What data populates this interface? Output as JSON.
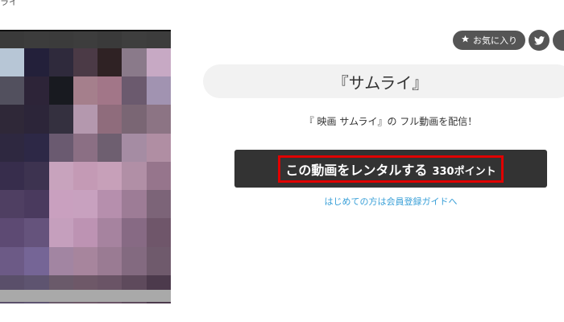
{
  "breadcrumb": "ライ",
  "actions": {
    "favorite_label": "お気に入り",
    "favorite_icon": "star-icon",
    "twitter_icon": "twitter-icon"
  },
  "video": {
    "title": "『サムライ』",
    "description": "『 映画 サムライ』の フル動画を配信！",
    "rent_label": "この動画をレンタルする",
    "rent_points": "330ポイント",
    "guide_link": "はじめての方は会員登録ガイドへ"
  },
  "colors": {
    "button_bg": "#333333",
    "highlight_border": "#e00000",
    "link": "#3aa0d8",
    "action_bg": "#555555",
    "title_bg": "#f2f2f2"
  },
  "thumbnail": {
    "description_free": true,
    "mosaic": [
      "#3a3a3a",
      "#3c3c3c",
      "#3b3b3b",
      "#3d3d3d",
      "#3a3a3a",
      "#3e3e3e",
      "#3c3c3c",
      "#b7c6d6",
      "#23203a",
      "#2f2a3c",
      "#4b3a46",
      "#2f2224",
      "#8a7a8a",
      "#c7a9c4",
      "#52505e",
      "#2d2438",
      "#181a20",
      "#a57f8c",
      "#a27688",
      "#6b5a6e",
      "#a193b1",
      "#2f2838",
      "#2c2539",
      "#34303f",
      "#b498ae",
      "#8f6c7c",
      "#7a6674",
      "#8c7484",
      "#2e2840",
      "#2d2846",
      "#6a5a70",
      "#8b6f84",
      "#6e5f70",
      "#a58ca3",
      "#b08ea3",
      "#372d4c",
      "#3d3350",
      "#c8a3bd",
      "#c49ab5",
      "#c7a0b9",
      "#b18fa6",
      "#96758c",
      "#4f3f62",
      "#4a3a5e",
      "#c9a0bf",
      "#c8a1bf",
      "#b68fad",
      "#9d7c96",
      "#7c6478",
      "#5d4a73",
      "#65537c",
      "#c59fbd",
      "#bd93b3",
      "#a6839f",
      "#876a84",
      "#6f566a",
      "#6c5a86",
      "#756596",
      "#a285a2",
      "#a7859d",
      "#9a7b93",
      "#836a80",
      "#6f5a6c",
      "#5a4f6a",
      "#5e5470",
      "#6a5a6a",
      "#6e5868",
      "#6a5466",
      "#5e4a5c",
      "#4c3a4c"
    ]
  }
}
